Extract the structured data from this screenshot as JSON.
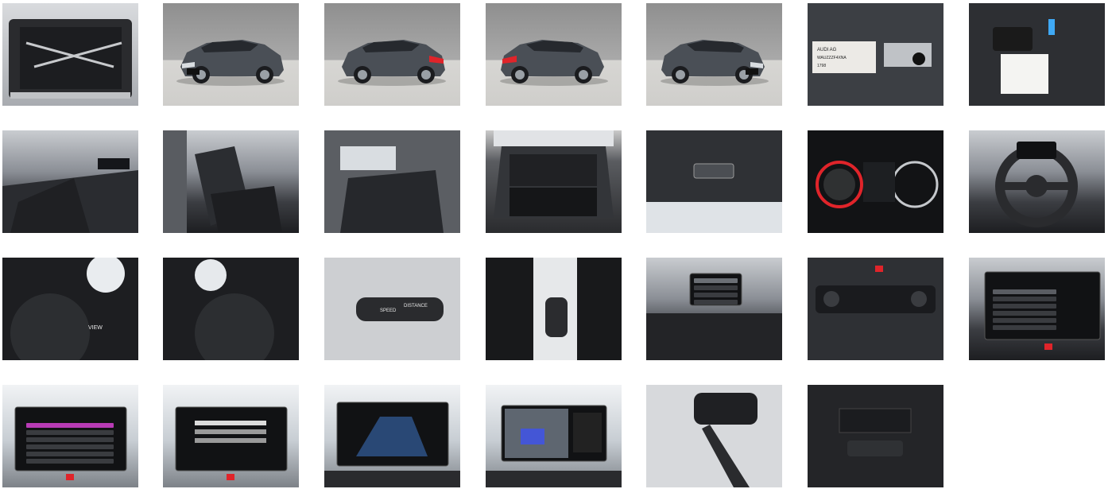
{
  "gallery": {
    "photos": [
      {
        "name": "photo-boot-cargo-bars"
      },
      {
        "name": "photo-front-three-quarter"
      },
      {
        "name": "photo-rear-three-quarter-left"
      },
      {
        "name": "photo-rear-three-quarter-right"
      },
      {
        "name": "photo-front-three-quarter-right"
      },
      {
        "name": "photo-vin-plate",
        "text": [
          "AUDI AG",
          "WAUZZZF4XNA",
          "1798"
        ]
      },
      {
        "name": "photo-keys-and-manual"
      },
      {
        "name": "photo-front-seats-passenger-side"
      },
      {
        "name": "photo-front-seat-driver-door"
      },
      {
        "name": "photo-rear-seats"
      },
      {
        "name": "photo-trunk-open"
      },
      {
        "name": "photo-tailgate-button"
      },
      {
        "name": "photo-digital-cockpit"
      },
      {
        "name": "photo-steering-wheel"
      },
      {
        "name": "photo-wheel-buttons-left",
        "text": [
          "VIEW"
        ]
      },
      {
        "name": "photo-wheel-buttons-right"
      },
      {
        "name": "photo-cruise-control-stalk",
        "text": [
          "SPEED",
          "DISTANCE"
        ]
      },
      {
        "name": "photo-gear-selector"
      },
      {
        "name": "photo-dashboard-center"
      },
      {
        "name": "photo-climate-control"
      },
      {
        "name": "photo-mmi-driver-assist"
      },
      {
        "name": "photo-mmi-media"
      },
      {
        "name": "photo-mmi-message"
      },
      {
        "name": "photo-mmi-navigation"
      },
      {
        "name": "photo-rear-camera"
      },
      {
        "name": "photo-rear-view-mirror"
      },
      {
        "name": "photo-rear-air-vents"
      }
    ]
  },
  "colors": {
    "car_paint": "#4a4f56",
    "studio_wall": "#9c9c9c",
    "screen_dark": "#111214",
    "accent_red": "#e0242a"
  }
}
